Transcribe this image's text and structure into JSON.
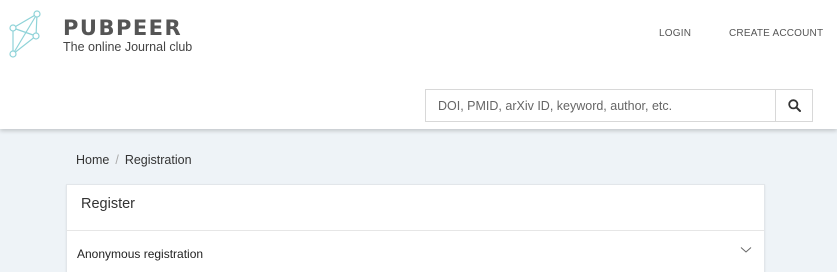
{
  "brand": {
    "name": "PUBPEER",
    "tagline": "The online Journal club"
  },
  "nav": {
    "login": "LOGIN",
    "create_account": "CREATE ACCOUNT"
  },
  "search": {
    "placeholder": "DOI, PMID, arXiv ID, keyword, author, etc.",
    "value": ""
  },
  "breadcrumb": {
    "home": "Home",
    "separator": "/",
    "current": "Registration"
  },
  "card": {
    "title": "Register",
    "section_label": "Anonymous registration"
  },
  "colors": {
    "logo": "#8fd3d8",
    "background": "#eef3f7"
  },
  "icons": {
    "logo": "pubpeer-logo-icon",
    "search": "search-icon",
    "chevron": "chevron-down-icon"
  }
}
